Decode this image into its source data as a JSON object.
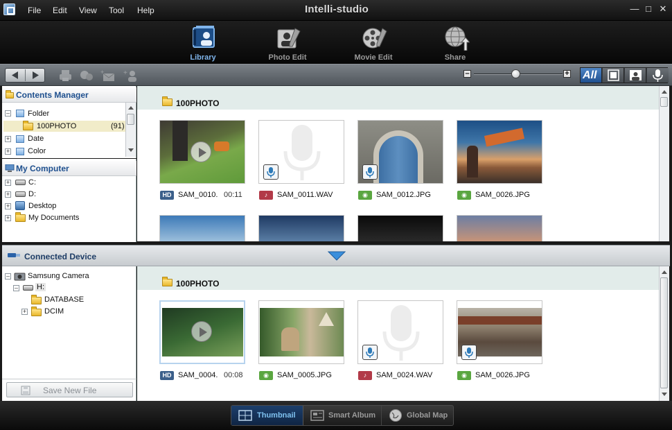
{
  "app": {
    "title": "Intelli-studio"
  },
  "menu": [
    "File",
    "Edit",
    "View",
    "Tool",
    "Help"
  ],
  "modules": [
    {
      "label": "Library",
      "icon": "library-icon",
      "active": true
    },
    {
      "label": "Photo Edit",
      "icon": "photo-edit-icon",
      "active": false
    },
    {
      "label": "Movie Edit",
      "icon": "movie-edit-icon",
      "active": false
    },
    {
      "label": "Share",
      "icon": "share-icon",
      "active": false
    }
  ],
  "filters": {
    "all": "All"
  },
  "contents_manager": {
    "title": "Contents Manager",
    "items": [
      {
        "label": "Folder"
      },
      {
        "label": "100PHOTO",
        "count": "(91)"
      },
      {
        "label": "Date"
      },
      {
        "label": "Color"
      }
    ]
  },
  "my_computer": {
    "title": "My Computer",
    "items": [
      "C:",
      "D:",
      "Desktop",
      "My Documents"
    ]
  },
  "connected_device": {
    "title": "Connected Device",
    "tree": [
      "Samsung Camera",
      "H:",
      "DATABASE",
      "DCIM"
    ],
    "save_button": "Save New File"
  },
  "library": {
    "folder": "100PHOTO",
    "items": [
      {
        "name": "SAM_0010.",
        "duration": "00:11",
        "type": "HD"
      },
      {
        "name": "SAM_0011.WAV",
        "type": "audio"
      },
      {
        "name": "SAM_0012.JPG",
        "type": "photo"
      },
      {
        "name": "SAM_0026.JPG",
        "type": "photo"
      }
    ]
  },
  "device": {
    "folder": "100PHOTO",
    "items": [
      {
        "name": "SAM_0004.",
        "duration": "00:08",
        "type": "HD"
      },
      {
        "name": "SAM_0005.JPG",
        "type": "photo"
      },
      {
        "name": "SAM_0024.WAV",
        "type": "audio"
      },
      {
        "name": "SAM_0026.JPG",
        "type": "photo"
      }
    ]
  },
  "badges": {
    "hd": "HD"
  },
  "view_modes": [
    {
      "label": "Thumbnail",
      "active": true
    },
    {
      "label": "Smart Album",
      "active": false
    },
    {
      "label": "Global Map",
      "active": false
    }
  ],
  "colors": {
    "accent": "#7fb4ea",
    "panel_title": "#1e4f8e",
    "photo_badge": "#5aa640",
    "audio_badge": "#b23a48",
    "hd_badge": "#3b5f8a"
  }
}
